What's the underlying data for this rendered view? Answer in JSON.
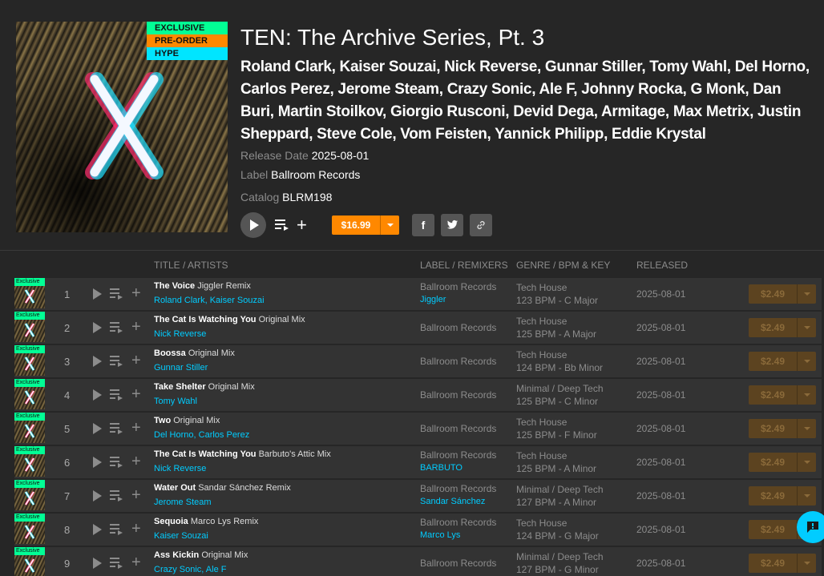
{
  "release": {
    "title": "TEN: The Archive Series, Pt. 3",
    "artists": "Roland Clark, Kaiser Souzai, Nick Reverse, Gunnar Stiller, Tomy Wahl, Del Horno, Carlos Perez, Jerome Steam, Crazy Sonic, Ale F, Johnny Rocka, G Monk, Dan Buri, Martin Stoilkov, Giorgio Rusconi, Devid Dega, Armitage, Max Metrix, Justin Sheppard, Steve Cole, Vom Feisten, Yannick Philipp, Eddie Krystal",
    "tags": [
      "EXCLUSIVE",
      "PRE-ORDER",
      "HYPE"
    ],
    "release_date_label": "Release Date",
    "release_date": "2025-08-01",
    "label_label": "Label",
    "label": "Ballroom Records",
    "catalog_label": "Catalog",
    "catalog": "BLRM198",
    "price": "$16.99"
  },
  "share": {
    "facebook": "f",
    "twitter": "t"
  },
  "colors": {
    "accent_orange": "#ff8800",
    "exclusive_green": "#02ff95",
    "hype_cyan": "#00e5ff",
    "link_blue": "#01ccff"
  },
  "table": {
    "headers": {
      "title": "TITLE / ARTISTS",
      "label": "LABEL / REMIXERS",
      "genre": "GENRE / BPM & KEY",
      "released": "RELEASED"
    },
    "thumb_badge": "Exclusive",
    "tracks": [
      {
        "num": "1",
        "name": "The Voice",
        "mix": "Jiggler Remix",
        "artists": "Roland Clark, Kaiser Souzai",
        "label": "Ballroom Records",
        "remixer": "Jiggler",
        "genre": "Tech House",
        "bpm_key": "123 BPM - C Major",
        "released": "2025-08-01",
        "price": "$2.49"
      },
      {
        "num": "2",
        "name": "The Cat Is Watching You",
        "mix": "Original Mix",
        "artists": "Nick Reverse",
        "label": "Ballroom Records",
        "remixer": "",
        "genre": "Tech House",
        "bpm_key": "125 BPM - A Major",
        "released": "2025-08-01",
        "price": "$2.49"
      },
      {
        "num": "3",
        "name": "Boossa",
        "mix": "Original Mix",
        "artists": "Gunnar Stiller",
        "label": "Ballroom Records",
        "remixer": "",
        "genre": "Tech House",
        "bpm_key": "124 BPM - Bb Minor",
        "released": "2025-08-01",
        "price": "$2.49"
      },
      {
        "num": "4",
        "name": "Take Shelter",
        "mix": "Original Mix",
        "artists": "Tomy Wahl",
        "label": "Ballroom Records",
        "remixer": "",
        "genre": "Minimal / Deep Tech",
        "bpm_key": "125 BPM - C Minor",
        "released": "2025-08-01",
        "price": "$2.49"
      },
      {
        "num": "5",
        "name": "Two",
        "mix": "Original Mix",
        "artists": "Del Horno, Carlos Perez",
        "label": "Ballroom Records",
        "remixer": "",
        "genre": "Tech House",
        "bpm_key": "125 BPM - F Minor",
        "released": "2025-08-01",
        "price": "$2.49"
      },
      {
        "num": "6",
        "name": "The Cat Is Watching You",
        "mix": "Barbuto's Attic Mix",
        "artists": "Nick Reverse",
        "label": "Ballroom Records",
        "remixer": "BARBUTO",
        "genre": "Tech House",
        "bpm_key": "125 BPM - A Minor",
        "released": "2025-08-01",
        "price": "$2.49"
      },
      {
        "num": "7",
        "name": "Water Out",
        "mix": "Sandar Sánchez Remix",
        "artists": "Jerome Steam",
        "label": "Ballroom Records",
        "remixer": "Sandar Sánchez",
        "genre": "Minimal / Deep Tech",
        "bpm_key": "127 BPM - A Minor",
        "released": "2025-08-01",
        "price": "$2.49"
      },
      {
        "num": "8",
        "name": "Sequoia",
        "mix": "Marco Lys Remix",
        "artists": "Kaiser Souzai",
        "label": "Ballroom Records",
        "remixer": "Marco Lys",
        "genre": "Tech House",
        "bpm_key": "124 BPM - G Major",
        "released": "2025-08-01",
        "price": "$2.49"
      },
      {
        "num": "9",
        "name": "Ass Kickin",
        "mix": "Original Mix",
        "artists": "Crazy Sonic, Ale F",
        "label": "Ballroom Records",
        "remixer": "",
        "genre": "Minimal / Deep Tech",
        "bpm_key": "127 BPM - G Minor",
        "released": "2025-08-01",
        "price": "$2.49"
      }
    ]
  }
}
